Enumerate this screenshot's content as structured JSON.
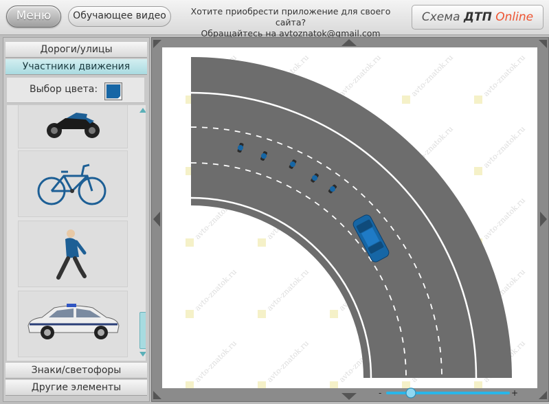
{
  "header": {
    "menu_label": "Меню",
    "video_label": "Обучающее видео",
    "promo_line1": "Хотите приобрести приложение для своего сайта?",
    "promo_line2": "Обращайтесь на avtoznatok@gmail.com",
    "brand_part1": "Схема ",
    "brand_part2": "ДТП",
    "brand_part3": " Online"
  },
  "sidebar": {
    "section_roads": "Дороги/улицы",
    "section_participants": "Участники движения",
    "color_label": "Выбор цвета:",
    "selected_color": "#1666a5",
    "items": [
      "motorcycle-icon",
      "bicycle-icon",
      "pedestrian-icon",
      "police-car-icon"
    ],
    "section_signs": "Знаки/светофоры",
    "section_other": "Другие элементы"
  },
  "canvas": {
    "watermark": "avto-znatok.ru",
    "zoom_minus": "-",
    "zoom_plus": "+",
    "zoom_level": 0.2
  },
  "colors": {
    "accent": "#a9dbe1",
    "vehicle": "#1666a5",
    "road": "#6d6d6d"
  }
}
